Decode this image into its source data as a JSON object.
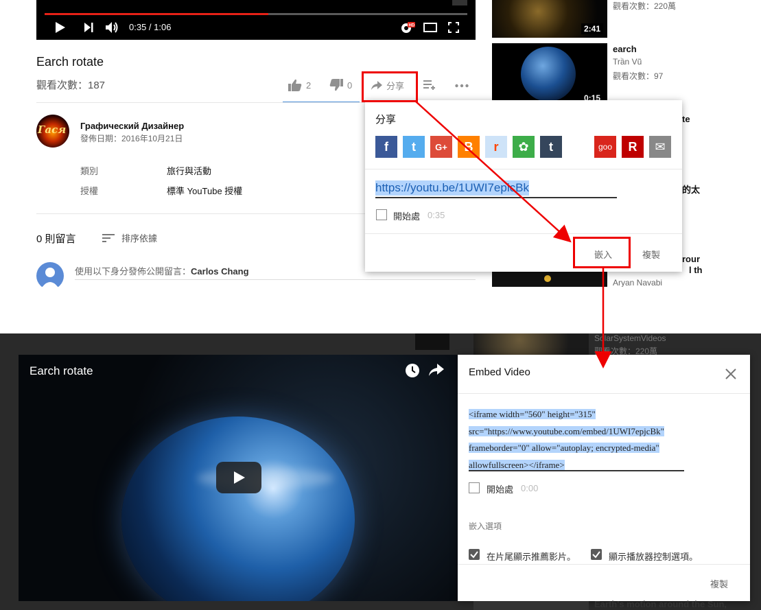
{
  "top": {
    "player": {
      "time": "0:35 / 1:06",
      "progress_fraction": 0.53
    },
    "video": {
      "title": "Earch rotate",
      "views": "觀看次數：187",
      "likes": "2",
      "dislikes": "0",
      "share_label": "分享"
    },
    "channel": {
      "name": "Графический Дизайнер",
      "published": "發佈日期：2016年10月21日",
      "avatar_text": "Гася"
    },
    "meta": [
      {
        "key": "類別",
        "value": "旅行與活動"
      },
      {
        "key": "授權",
        "value": "標準 YouTube 授權"
      }
    ],
    "comments": {
      "count": "0 則留言",
      "sort_label": "排序依據",
      "prompt_prefix": "使用以下身分發佈公開留言：",
      "prompt_user": "Carlos Chang"
    },
    "sidebar": [
      {
        "views": "觀看次數：220萬",
        "duration": "2:41"
      },
      {
        "title": "earch",
        "author": "Trần Vũ",
        "views": "觀看次數：97",
        "duration": "0:15"
      },
      {
        "title_fragment": "te"
      },
      {
        "title_fragment": "的太"
      },
      {
        "title_fragment": "rour",
        "title_fragment2": "l th",
        "author": "Aryan Navabi"
      }
    ],
    "share_popup": {
      "title": "分享",
      "icons": [
        {
          "name": "facebook-icon",
          "color": "#3b5998",
          "glyph": "f"
        },
        {
          "name": "twitter-icon",
          "color": "#55acee",
          "glyph": "t"
        },
        {
          "name": "google-plus-icon",
          "color": "#dd4b39",
          "glyph": "G+"
        },
        {
          "name": "blogger-icon",
          "color": "#ff8000",
          "glyph": "B"
        },
        {
          "name": "reddit-icon",
          "color": "#cee3f8",
          "glyph": "r"
        },
        {
          "name": "kakao-icon",
          "color": "#3dad49",
          "glyph": "✿"
        },
        {
          "name": "tumblr-icon",
          "color": "#35465c",
          "glyph": "t"
        },
        {
          "name": "goo-icon",
          "color": "#d9251c",
          "glyph": "goo"
        },
        {
          "name": "rakuten-icon",
          "color": "#bf0000",
          "glyph": "R"
        },
        {
          "name": "email-icon",
          "color": "#888888",
          "glyph": "✉"
        }
      ],
      "url": "https://youtu.be/1UWI7epicBk",
      "start_at_label": "開始處",
      "start_at_time": "0:35",
      "embed_button": "嵌入",
      "copy_button": "複製"
    }
  },
  "bottom": {
    "video_title": "Earch rotate",
    "sidebar": [
      {
        "author": "SolarSystemVideos",
        "views": "觀看次數：220萬"
      },
      {
        "title": "Earth's motion around the Sun,"
      }
    ],
    "embed_dialog": {
      "title": "Embed Video",
      "code_lines": [
        "<iframe width=\"560\" height=\"315\"",
        "src=\"https://www.youtube.com/embed/1UWI7epjcBk\"",
        "frameborder=\"0\" allow=\"autoplay; encrypted-media\"",
        "allowfullscreen></iframe>"
      ],
      "start_at_label": "開始處",
      "start_at_time": "0:00",
      "options_heading": "嵌入選項",
      "option_suggested": "在片尾顯示推薦影片。",
      "option_controls": "顯示播放器控制選項。",
      "copy_button": "複製"
    }
  },
  "colors": {
    "annotation_red": "#e00000",
    "youtube_red": "#e62117",
    "selection_blue": "#b3d4fc"
  }
}
